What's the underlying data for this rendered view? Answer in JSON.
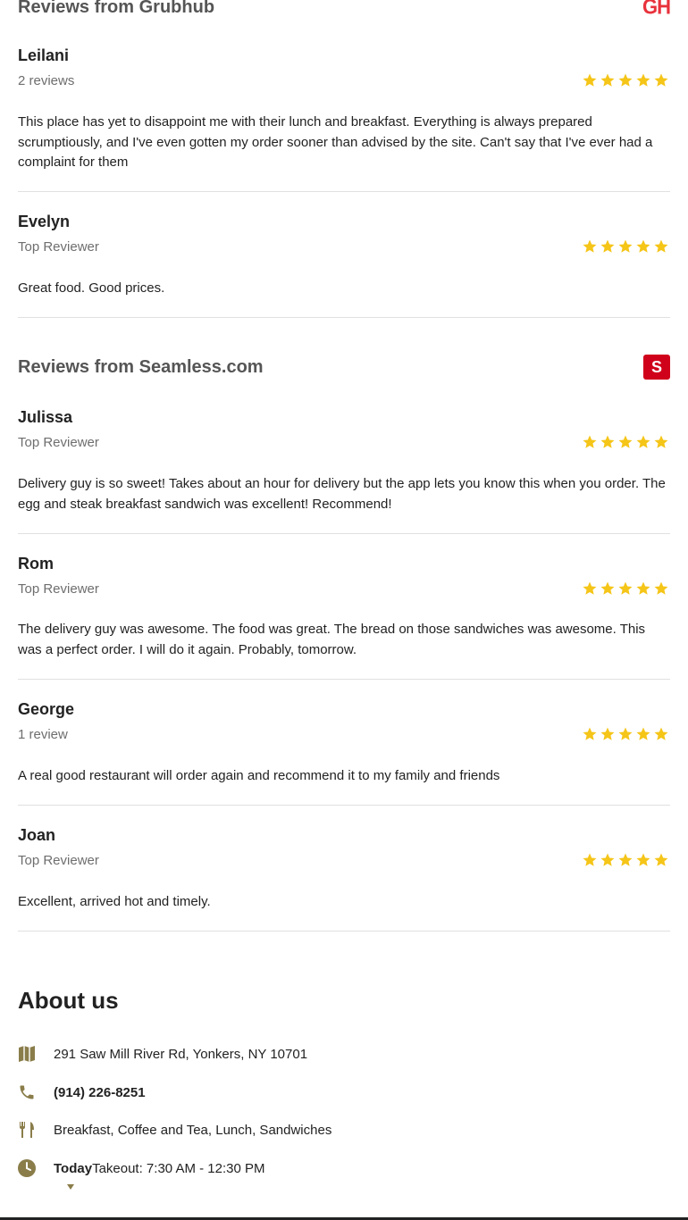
{
  "grubhub": {
    "title": "Reviews from Grubhub",
    "logo_text": "GH",
    "reviews": [
      {
        "name": "Leilani",
        "meta": "2 reviews",
        "stars": 5,
        "text": "This place has yet to disappoint me with their lunch and breakfast. Everything is always prepared scrumptiously, and I've even gotten my order sooner than advised by the site. Can't say that I've ever had a complaint for them"
      },
      {
        "name": "Evelyn",
        "meta": "Top Reviewer",
        "stars": 5,
        "text": "Great food. Good prices."
      }
    ]
  },
  "seamless": {
    "title": "Reviews from Seamless.com",
    "logo_text": "S",
    "reviews": [
      {
        "name": "Julissa",
        "meta": "Top Reviewer",
        "stars": 5,
        "text": "Delivery guy is so sweet! Takes about an hour for delivery but the app lets you know this when you order. The egg and steak breakfast sandwich was excellent! Recommend!"
      },
      {
        "name": "Rom",
        "meta": "Top Reviewer",
        "stars": 5,
        "text": "The delivery guy was awesome. The food was great. The bread on those sandwiches was awesome. This was a perfect order. I will do it again. Probably, tomorrow."
      },
      {
        "name": "George",
        "meta": "1 review",
        "stars": 5,
        "text": "A real good restaurant will order again and recommend it to my family and friends"
      },
      {
        "name": "Joan",
        "meta": "Top Reviewer",
        "stars": 5,
        "text": "Excellent, arrived hot and timely."
      }
    ]
  },
  "about": {
    "title": "About us",
    "address": "291 Saw Mill River Rd, Yonkers, NY 10701",
    "phone": "(914) 226-8251",
    "categories": "Breakfast, Coffee and Tea, Lunch, Sandwiches",
    "hours_day": "Today",
    "hours_text": "Takeout: 7:30 AM - 12:30 PM"
  },
  "colors": {
    "star": "#f5c518",
    "icon": "#8a7d4a",
    "grubhub": "#e8323c",
    "seamless": "#d0021b"
  },
  "icons": [
    "map-icon",
    "phone-icon",
    "utensils-icon",
    "clock-icon",
    "star-icon"
  ]
}
